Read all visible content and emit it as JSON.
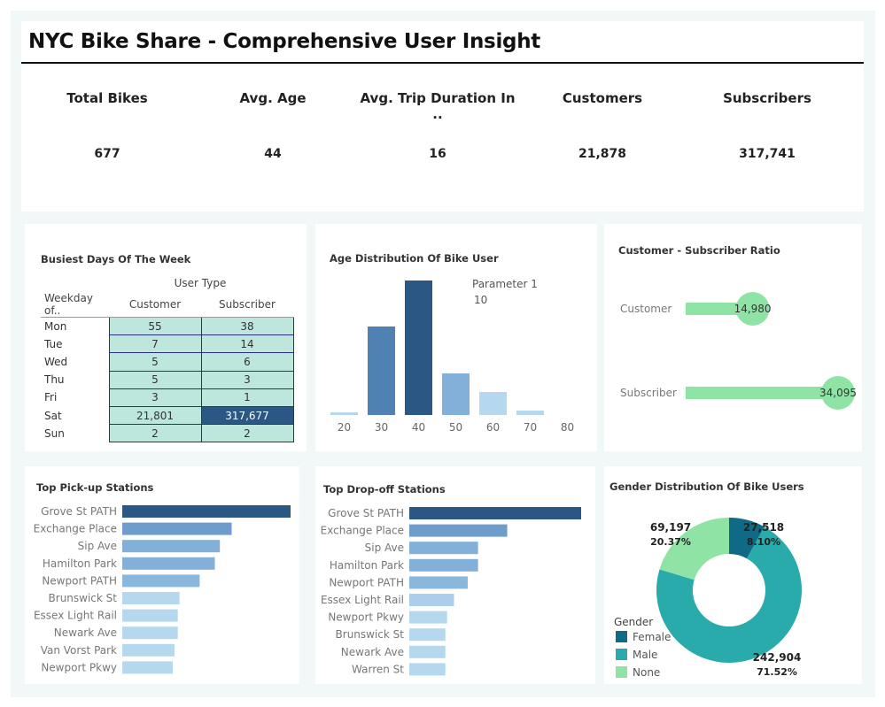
{
  "title": "NYC Bike Share - Comprehensive User Insight",
  "kpis": [
    {
      "label": "Total Bikes",
      "value": "677"
    },
    {
      "label": "Avg. Age",
      "value": "44"
    },
    {
      "label": "Avg. Trip Duration In ..",
      "value": "16"
    },
    {
      "label": "Customers",
      "value": "21,878"
    },
    {
      "label": "Subscribers",
      "value": "317,741"
    }
  ],
  "colors": {
    "dark": "#2a5783",
    "mid": "#4f81b3",
    "light": "#82b0d8",
    "lighter": "#b6d8ee",
    "mint": "#bde6dc",
    "green": "#8fe3a5",
    "teal_dark": "#0f6b85",
    "teal": "#2aabab",
    "green_light": "#8fe3a5"
  },
  "chart_data": [
    {
      "type": "table",
      "title": "Busiest Days Of The Week",
      "column_group": "User Type",
      "row_header": "Weekday of..",
      "columns": [
        "Customer",
        "Subscriber"
      ],
      "rows": [
        {
          "day": "Mon",
          "customer": "55",
          "subscriber": "38"
        },
        {
          "day": "Tue",
          "customer": "7",
          "subscriber": "14"
        },
        {
          "day": "Wed",
          "customer": "5",
          "subscriber": "6"
        },
        {
          "day": "Thu",
          "customer": "5",
          "subscriber": "3"
        },
        {
          "day": "Fri",
          "customer": "3",
          "subscriber": "1"
        },
        {
          "day": "Sat",
          "customer": "21,801",
          "subscriber": "317,677"
        },
        {
          "day": "Sun",
          "customer": "2",
          "subscriber": "2"
        }
      ]
    },
    {
      "type": "bar",
      "title": "Age Distribution Of Bike User",
      "categories": [
        "20",
        "30",
        "40",
        "50",
        "60",
        "70",
        "80"
      ],
      "values": [
        3,
        100,
        152,
        47,
        26,
        5,
        0
      ],
      "ylim": [
        0,
        160
      ],
      "parameter_label": "Parameter 1",
      "parameter_value": "10"
    },
    {
      "type": "bar",
      "title": "Customer - Subscriber Ratio",
      "orientation": "horizontal",
      "categories": [
        "Customer",
        "Subscriber"
      ],
      "values": [
        14980,
        34095
      ],
      "labels": [
        "14,980",
        "34,095"
      ],
      "xlim": [
        0,
        34095
      ]
    },
    {
      "type": "bar",
      "title": "Top Pick-up Stations",
      "orientation": "horizontal",
      "categories": [
        "Grove St PATH",
        "Exchange Place",
        "Sip Ave",
        "Hamilton Park",
        "Newport PATH",
        "Brunswick St",
        "Essex Light Rail",
        "Newark Ave",
        "Van Vorst Park",
        "Newport Pkwy"
      ],
      "values": [
        100,
        65,
        58,
        55,
        46,
        34,
        33,
        33,
        31,
        30
      ],
      "xlim": [
        0,
        100
      ]
    },
    {
      "type": "bar",
      "title": "Top Drop-off Stations",
      "orientation": "horizontal",
      "categories": [
        "Grove St PATH",
        "Exchange Place",
        "Sip Ave",
        "Hamilton Park",
        "Newport PATH",
        "Essex Light Rail",
        "Newport Pkwy",
        "Brunswick St",
        "Newark Ave",
        "Warren St"
      ],
      "values": [
        100,
        57,
        40,
        40,
        34,
        26,
        22,
        21,
        21,
        21
      ],
      "xlim": [
        0,
        100
      ]
    },
    {
      "type": "pie",
      "title": "Gender Distribution Of Bike Users",
      "legend_title": "Gender",
      "slices": [
        {
          "name": "Female",
          "value": 27518,
          "label": "27,518",
          "pct": "8.10%"
        },
        {
          "name": "Male",
          "value": 242904,
          "label": "242,904",
          "pct": "71.52%"
        },
        {
          "name": "None",
          "value": 69197,
          "label": "69,197",
          "pct": "20.37%"
        }
      ]
    }
  ]
}
